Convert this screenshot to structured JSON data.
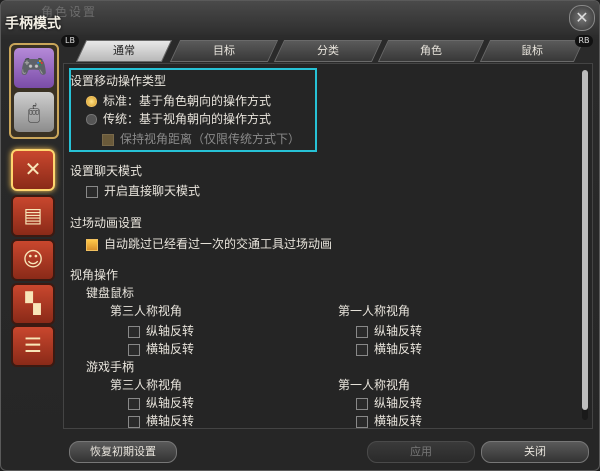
{
  "window": {
    "ghost_title": "角色设置",
    "title": "手柄模式",
    "close_glyph": "✕"
  },
  "rail": {
    "mode_icons": [
      "gamepad-icon",
      "mouse-icon"
    ],
    "category_icons": [
      "crosshair-icon",
      "id-card-icon",
      "character-icon",
      "checker-icon",
      "chat-icon"
    ]
  },
  "tabs": {
    "lb": "LB",
    "rb": "RB",
    "items": [
      "通常",
      "目标",
      "分类",
      "角色",
      "鼠标"
    ]
  },
  "sections": {
    "move_type": {
      "label": "设置移动操作类型",
      "standard": "标准：基于角色朝向的操作方式",
      "traditional": "传统：基于视角朝向的操作方式",
      "keep_distance": "保持视角距离（仅限传统方式下）"
    },
    "chat": {
      "label": "设置聊天模式",
      "direct": "开启直接聊天模式"
    },
    "cutscene": {
      "label": "过场动画设置",
      "skip": "自动跳过已经看过一次的交通工具过场动画"
    },
    "camera": {
      "label": "视角操作",
      "keyboard_mouse": "键盘鼠标",
      "gamepad": "游戏手柄",
      "third_person": "第三人称视角",
      "first_person": "第一人称视角",
      "invert_vertical": "纵轴反转",
      "invert_horizontal": "横轴反转"
    }
  },
  "footer": {
    "reset": "恢复初期设置",
    "apply": "应用",
    "close": "关闭"
  },
  "colors": {
    "highlight": "#27c2d6",
    "accent": "#f0c060"
  }
}
